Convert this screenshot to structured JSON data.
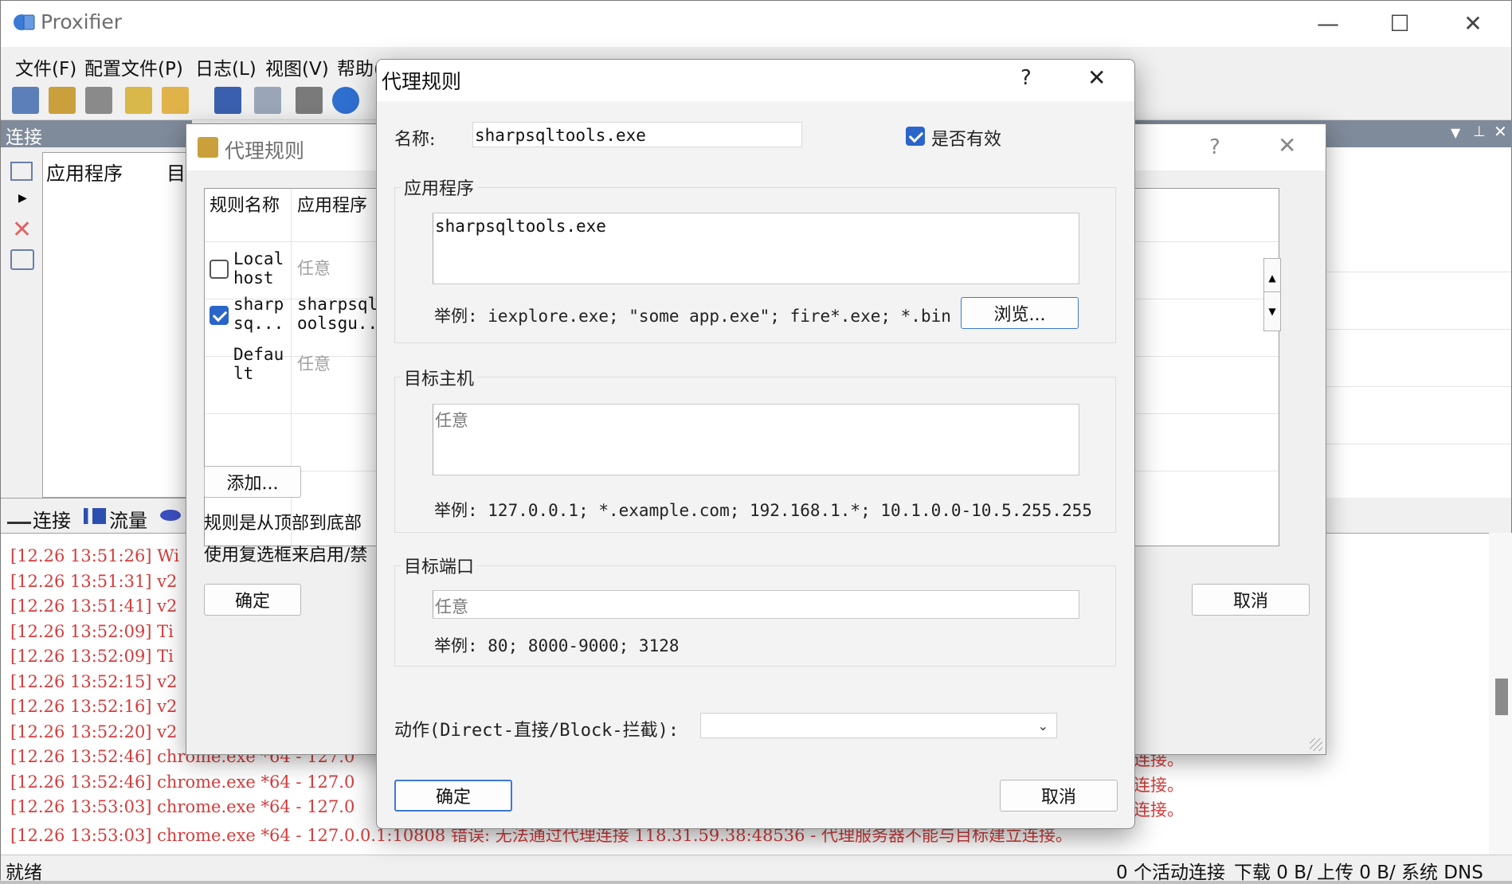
{
  "app": {
    "title": "Proxifier"
  },
  "menu": [
    "文件(F)",
    "配置文件(P)",
    "日志(L)",
    "视图(V)",
    "帮助(H)"
  ],
  "left_pane": {
    "title": "连接",
    "columns": [
      "应用程序",
      "目"
    ],
    "tabs": [
      "连接",
      "流量"
    ]
  },
  "bg_dialog": {
    "title": "代理规则",
    "columns": [
      "规则名称",
      "应用程序"
    ],
    "rules": [
      {
        "enabled": false,
        "name": "Local\nhost",
        "app": "任意",
        "app_placeholder": true
      },
      {
        "enabled": true,
        "name": "sharp\nsq...",
        "app": "sharpsqlt\noolsgu...",
        "app_placeholder": false
      },
      {
        "enabled": null,
        "name": "Defau\nlt",
        "app": "任意",
        "app_placeholder": true
      }
    ],
    "add_button": "添加...",
    "hint1": "规则是从顶部到底部",
    "hint2": "使用复选框来启用/禁",
    "ok_button": "确定",
    "cancel_button": "取消"
  },
  "dialog": {
    "title": "代理规则",
    "help": "?",
    "name_label": "名称:",
    "name_value": "sharpsqltools.exe",
    "enabled_label": "是否有效",
    "enabled": true,
    "apps_group": "应用程序",
    "apps_value": "sharpsqltools.exe",
    "apps_example": "举例: iexplore.exe; \"some app.exe\"; fire*.exe; *.bin",
    "browse_button": "浏览...",
    "hosts_group": "目标主机",
    "hosts_placeholder": "任意",
    "hosts_example": "举例: 127.0.0.1; *.example.com; 192.168.1.*; 10.1.0.0-10.5.255.255",
    "ports_group": "目标端口",
    "ports_placeholder": "任意",
    "ports_example": "举例: 80; 8000-9000; 3128",
    "action_label": "动作(Direct-直接/Block-拦截):",
    "action_value": "",
    "ok_button": "确定",
    "cancel_button": "取消"
  },
  "log": [
    "[12.26 13:51:26] Wi",
    "[12.26 13:51:31] v2",
    "[12.26 13:51:41] v2",
    "[12.26 13:52:09] Ti",
    "[12.26 13:52:09] Ti",
    "[12.26 13:52:15] v2",
    "[12.26 13:52:16] v2",
    "[12.26 13:52:20] v2",
    "[12.26 13:52:46] chrome.exe *64 - 127.0",
    "[12.26 13:52:46] chrome.exe *64 - 127.0",
    "[12.26 13:53:03] chrome.exe *64 - 127.0",
    "[12.26 13:53:03] chrome.exe *64 - 127.0.0.1:10808 错误: 无法通过代理连接 118.31.59.38:48536 - 代理服务器不能与目标建立连接。"
  ],
  "log_tail": [
    "连接。",
    "连接。",
    "连接。"
  ],
  "status": {
    "left": "就绪",
    "connections": "0 个活动连接",
    "download": "下载 0 B/",
    "upload": "上传 0 B/",
    "dns": "系统 DNS"
  }
}
